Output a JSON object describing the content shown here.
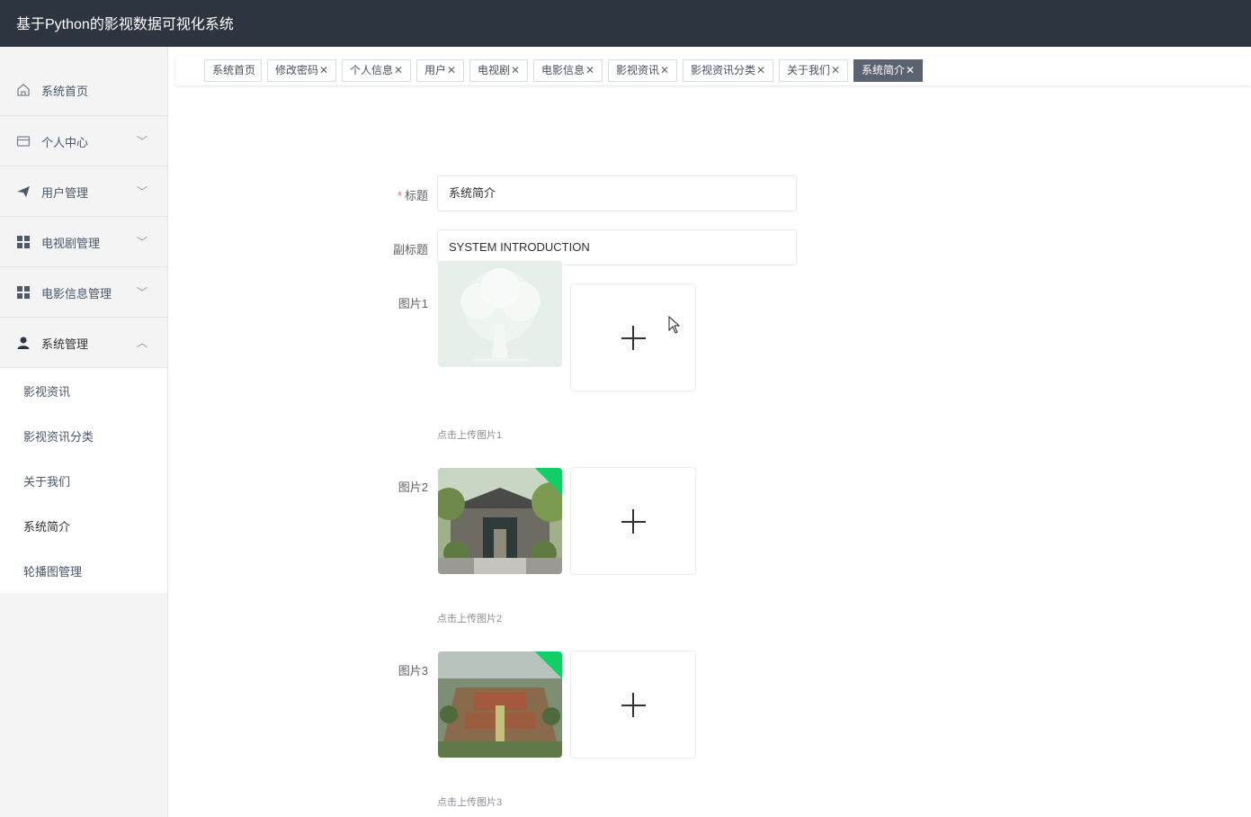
{
  "app": {
    "title": "基于Python的影视数据可视化系统"
  },
  "sidebar": {
    "items": [
      {
        "label": "系统首页",
        "icon": "home-icon"
      },
      {
        "label": "个人中心",
        "icon": "wallet-icon",
        "arrow": "down"
      },
      {
        "label": "用户管理",
        "icon": "send-icon",
        "arrow": "down"
      },
      {
        "label": "电视剧管理",
        "icon": "grid-icon",
        "arrow": "down"
      },
      {
        "label": "电影信息管理",
        "icon": "grid-icon",
        "arrow": "down"
      },
      {
        "label": "系统管理",
        "icon": "user-icon",
        "arrow": "up"
      }
    ],
    "submenu": [
      "影视资讯",
      "影视资讯分类",
      "关于我们",
      "系统简介",
      "轮播图管理"
    ],
    "arrow_down": "﹀",
    "arrow_up": "︿"
  },
  "tabs": [
    "系统首页",
    "修改密码",
    "个人信息",
    "用户",
    "电视剧",
    "电影信息",
    "影视资讯",
    "影视资讯分类",
    "关于我们",
    "系统简介"
  ],
  "tab_close": "✕",
  "form": {
    "title_label": "标题",
    "title_required_mark": "*",
    "title_value": "系统简介",
    "subtitle_label": "副标题",
    "subtitle_value": "SYSTEM INTRODUCTION",
    "images": [
      {
        "label": "图片1",
        "hint": "点击上传图片1"
      },
      {
        "label": "图片2",
        "hint": "点击上传图片2"
      },
      {
        "label": "图片3",
        "hint": "点击上传图片3"
      }
    ]
  },
  "colors": {
    "topbar": "#2d3540",
    "sidebar": "#f4f4f5",
    "active_tab": "#5b6270",
    "success": "#13ce66",
    "required": "#f56c6c"
  }
}
